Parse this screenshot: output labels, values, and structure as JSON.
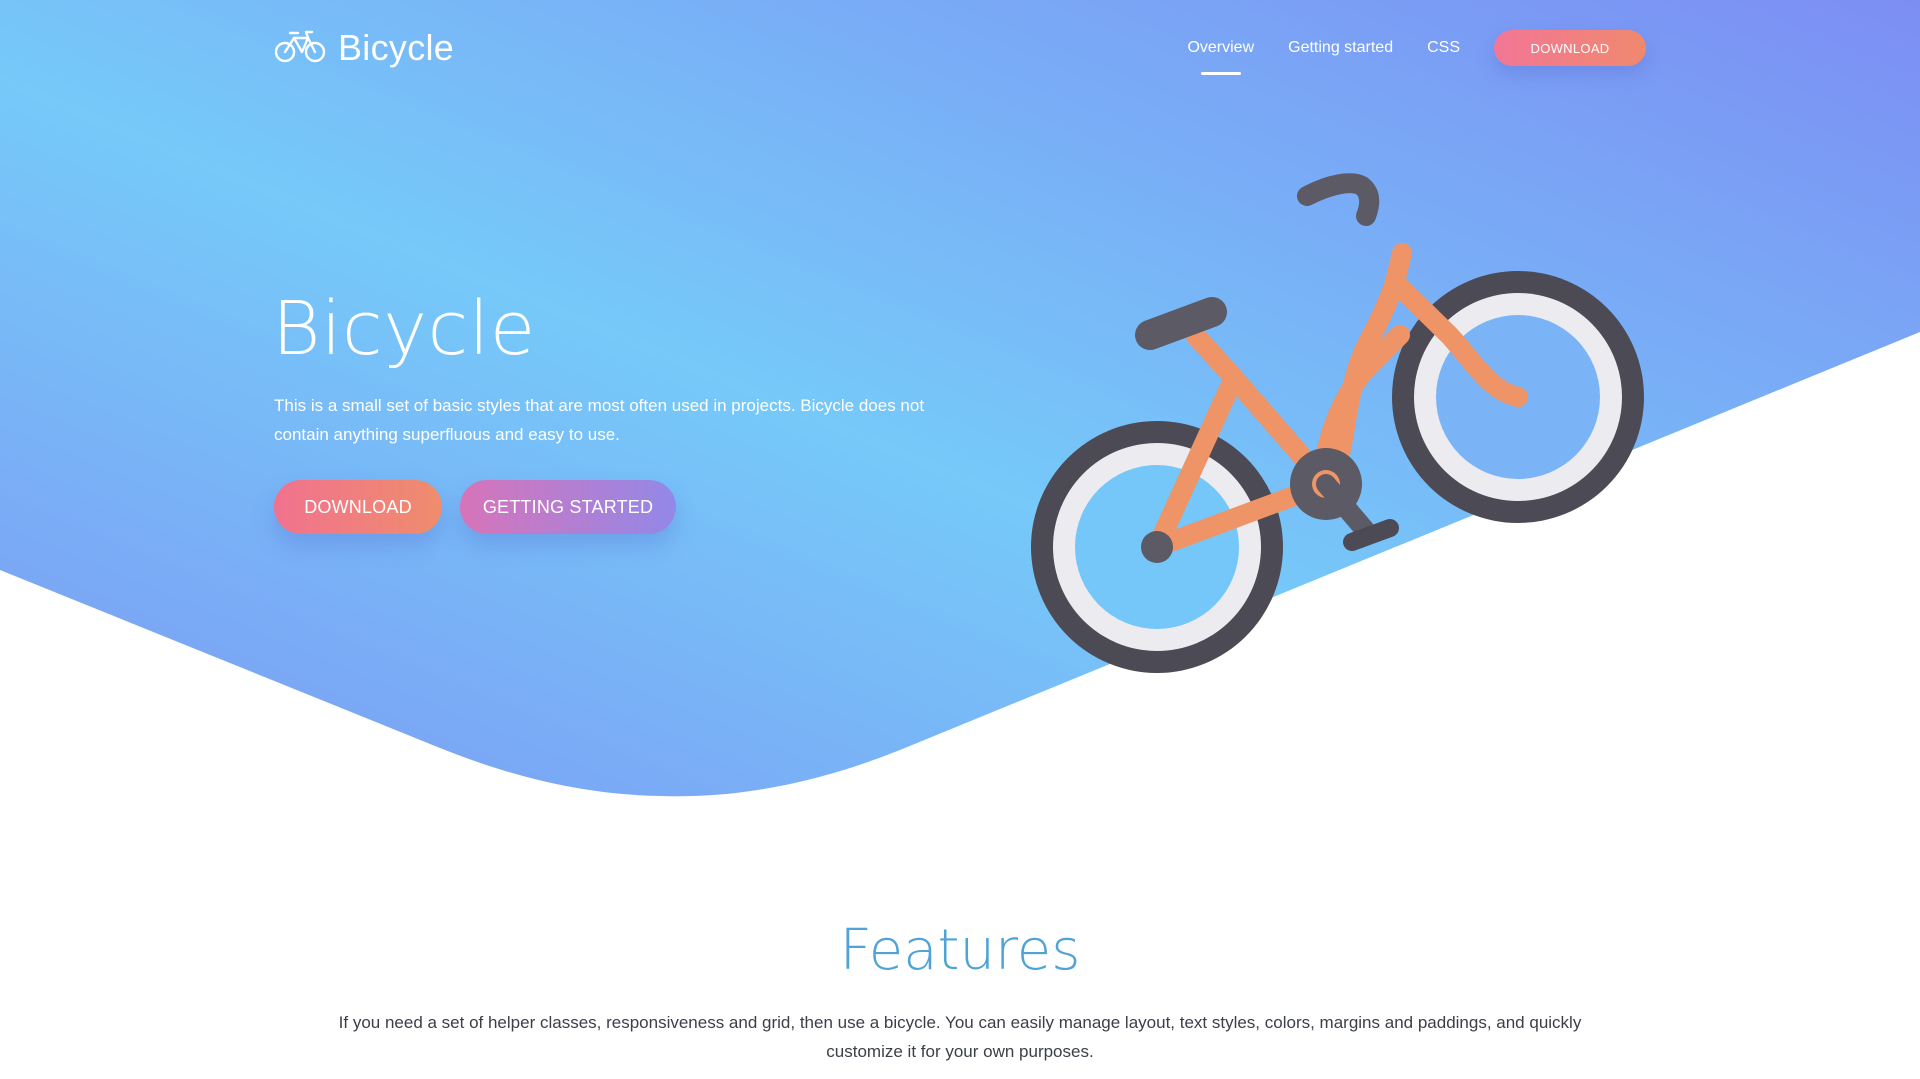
{
  "nav": {
    "brand": "Bicycle",
    "links": [
      "Overview",
      "Getting started",
      "CSS"
    ],
    "download_label": "DOWNLOAD"
  },
  "hero": {
    "title": "Bicycle",
    "description": "This is a small set of basic styles that are most often used in projects. Bicycle does not contain anything superfluous and easy to use.",
    "download_label": "DOWNLOAD",
    "getting_started_label": "GETTING STARTED"
  },
  "features": {
    "title": "Features",
    "description": "If you need a set of helper classes, responsiveness and grid, then use a bicycle. You can easily manage layout, text styles, colors, margins and paddings, and quickly customize it for your own purposes."
  },
  "colors": {
    "hero_gradient_start": "#7fa0f2",
    "hero_gradient_mid": "#76c8f8",
    "hero_gradient_end": "#7c8ff3",
    "accent_pink": "#f27696",
    "accent_orange": "#f0896e",
    "features_title": "#4fa3d6",
    "bike_frame": "#ee9466",
    "bike_tire": "#4c4a55",
    "bike_rim": "#e9e9ef"
  },
  "icons": {
    "brand": "bicycle-icon"
  }
}
